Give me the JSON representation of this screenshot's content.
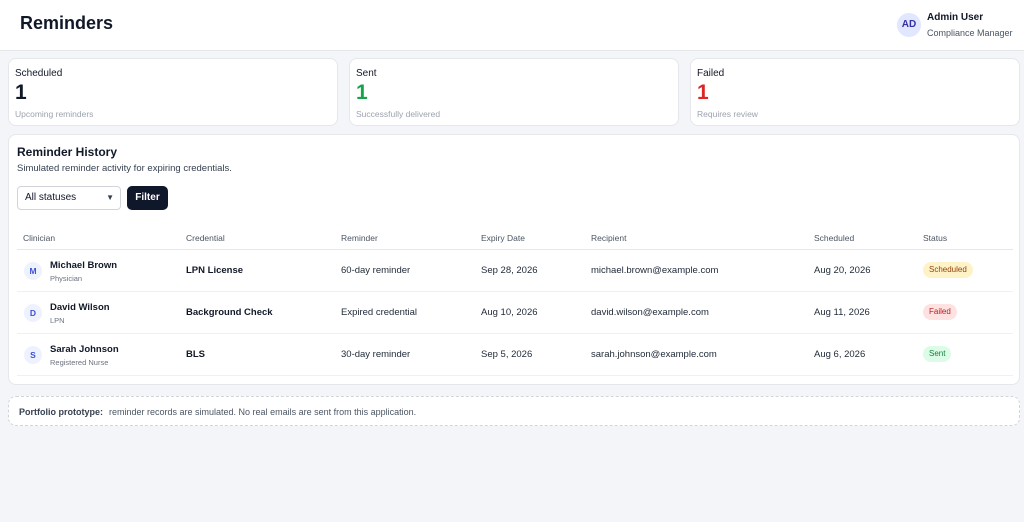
{
  "header": {
    "title": "Reminders",
    "user": {
      "initials": "AD",
      "name": "Admin User",
      "role": "Compliance Manager"
    }
  },
  "stats": [
    {
      "title": "Scheduled",
      "value": "1",
      "sub": "Upcoming reminders",
      "color": "#111827"
    },
    {
      "title": "Sent",
      "value": "1",
      "sub": "Successfully delivered",
      "color": "#16a34a"
    },
    {
      "title": "Failed",
      "value": "1",
      "sub": "Requires review",
      "color": "#dc2626"
    }
  ],
  "history": {
    "title": "Reminder History",
    "subtitle": "Simulated reminder activity for expiring credentials.",
    "filter": {
      "selected": "All statuses",
      "button_label": "Filter"
    },
    "columns": [
      "Clinician",
      "Credential",
      "Reminder",
      "Expiry Date",
      "Recipient",
      "Scheduled",
      "Status"
    ],
    "rows": [
      {
        "initial": "M",
        "name": "Michael Brown",
        "role": "Physician",
        "credential": "LPN License",
        "reminder": "60-day reminder",
        "expiry": "Sep 28, 2026",
        "recipient": "michael.brown@example.com",
        "scheduled": "Aug 20, 2026",
        "status": "Scheduled"
      },
      {
        "initial": "D",
        "name": "David Wilson",
        "role": "LPN",
        "credential": "Background Check",
        "reminder": "Expired credential",
        "expiry": "Aug 10, 2026",
        "recipient": "david.wilson@example.com",
        "scheduled": "Aug 11, 2026",
        "status": "Failed"
      },
      {
        "initial": "S",
        "name": "Sarah Johnson",
        "role": "Registered Nurse",
        "credential": "BLS",
        "reminder": "30-day reminder",
        "expiry": "Sep 5, 2026",
        "recipient": "sarah.johnson@example.com",
        "scheduled": "Aug 6, 2026",
        "status": "Sent"
      }
    ]
  },
  "status_colors": {
    "Scheduled": {
      "bg": "#fef3c7",
      "fg": "#92400e"
    },
    "Failed": {
      "bg": "#fee2e2",
      "fg": "#b91c1c"
    },
    "Sent": {
      "bg": "#dcfce7",
      "fg": "#15803d"
    }
  },
  "footer": {
    "strong": "Portfolio prototype:",
    "text": "reminder records are simulated. No real emails are sent from this application."
  }
}
